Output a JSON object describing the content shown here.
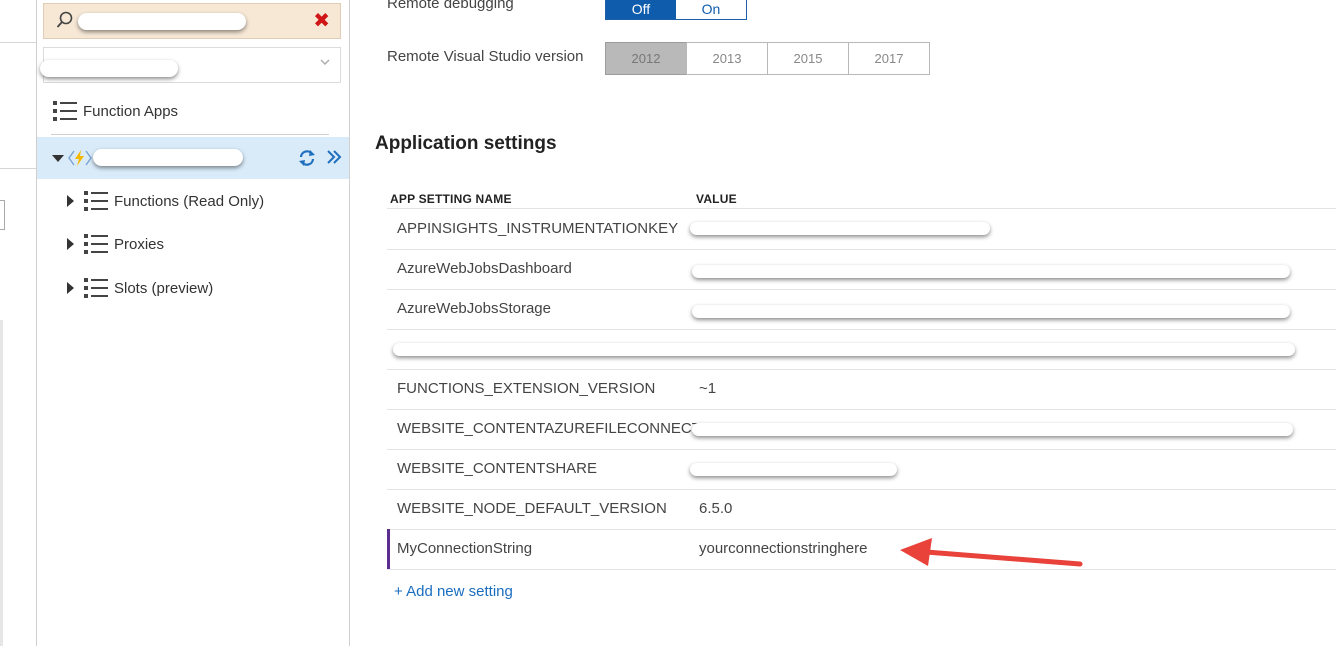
{
  "colors": {
    "accent": "#0f5cad",
    "selected_row": "#d9ebf9",
    "search_bg": "#f7e8d6",
    "clear_red": "#d01717",
    "new_setting_marker": "#5c2d91",
    "arrow_red": "#e8423a",
    "link_blue": "#1a6ec0"
  },
  "nav": {
    "search": {
      "value": "",
      "icon": "search-icon",
      "clear_icon": "close-icon",
      "clear_glyph": "✖"
    },
    "subscription": {
      "selected": "",
      "icon": "chevron-down-icon"
    },
    "root": {
      "label": "Function Apps",
      "icon": "list-icon"
    },
    "app": {
      "name": "",
      "icons": [
        "caret-down-icon",
        "function-app-icon",
        "refresh-icon",
        "expand-icon"
      ]
    },
    "children": [
      {
        "label": "Functions (Read Only)",
        "icon": "list-icon"
      },
      {
        "label": "Proxies",
        "icon": "list-icon"
      },
      {
        "label": "Slots (preview)",
        "icon": "list-icon"
      }
    ]
  },
  "main": {
    "remote_debugging": {
      "label": "Remote debugging",
      "options": [
        "Off",
        "On"
      ],
      "selected": "Off"
    },
    "vs_version": {
      "label": "Remote Visual Studio version",
      "options": [
        "2012",
        "2013",
        "2015",
        "2017"
      ],
      "selected": "2012"
    },
    "section_title": "Application settings",
    "table": {
      "headers": [
        "APP SETTING NAME",
        "VALUE"
      ],
      "rows": [
        {
          "name": "APPINSIGHTS_INSTRUMENTATIONKEY",
          "value": "",
          "redacted": true
        },
        {
          "name": "AzureWebJobsDashboard",
          "value": "",
          "redacted": true
        },
        {
          "name": "AzureWebJobsStorage",
          "value": "",
          "redacted": true
        },
        {
          "name": "",
          "value": "",
          "redacted": true
        },
        {
          "name": "FUNCTIONS_EXTENSION_VERSION",
          "value": "~1",
          "redacted": false
        },
        {
          "name": "WEBSITE_CONTENTAZUREFILECONNECTI...",
          "value": "",
          "redacted": true
        },
        {
          "name": "WEBSITE_CONTENTSHARE",
          "value": "",
          "redacted": true
        },
        {
          "name": "WEBSITE_NODE_DEFAULT_VERSION",
          "value": "6.5.0",
          "redacted": false
        },
        {
          "name": "MyConnectionString",
          "value": "yourconnectionstringhere",
          "redacted": false,
          "highlight": true
        }
      ]
    },
    "add_setting": "+ Add new setting"
  }
}
